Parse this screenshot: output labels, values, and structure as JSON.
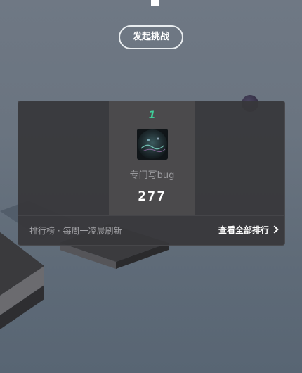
{
  "header": {
    "challenge_button_label": "发起挑战"
  },
  "leaderboard": {
    "entries": [
      {
        "rank": "1",
        "name": "专门写bug",
        "score": "277"
      }
    ],
    "footer_note": "排行榜 · 每周一凌晨刷新",
    "view_all_label": "查看全部排行"
  },
  "colors": {
    "rank_accent": "#3fcf9a",
    "panel_bg": "#37373a",
    "highlight_column": "#4b4a4c"
  },
  "icons": {
    "view_all": "chevron-right-icon"
  }
}
